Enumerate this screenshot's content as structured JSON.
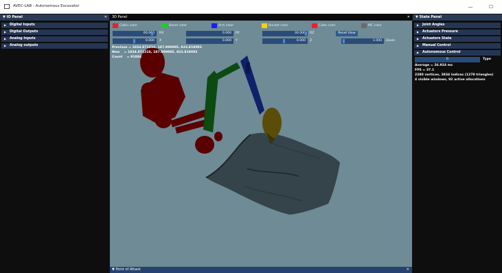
{
  "window": {
    "title": "AVEC-LAB - Autonomous Excavator",
    "minimize": "—",
    "maximize": "☐"
  },
  "io_panel": {
    "title": "IO Panel",
    "close": "✕",
    "items": [
      "Digital Inputs",
      "Digital Outputs",
      "Analog Inputs",
      "Analog outputs"
    ]
  },
  "panel_3d": {
    "title": "3D Panel",
    "close": "✕",
    "colors": [
      {
        "label": "Cabin color",
        "hex": "#e8222b"
      },
      {
        "label": "Boom color",
        "hex": "#18d31c"
      },
      {
        "label": "Arm color",
        "hex": "#1a1ef0"
      },
      {
        "label": "Bucket color",
        "hex": "#f4d20b"
      },
      {
        "label": "Cube color",
        "hex": "#e8222b"
      },
      {
        "label": "MC color",
        "hex": "#6a6a6a"
      }
    ],
    "row1": [
      {
        "value": "60.000",
        "label": "RX"
      },
      {
        "value": "0.000",
        "label": "RY"
      },
      {
        "value": "30.000",
        "label": "RZ"
      }
    ],
    "reset_view": "Reset View",
    "row2": [
      {
        "value": "0.000",
        "label": "X"
      },
      {
        "value": "0.000",
        "label": "Y"
      },
      {
        "value": "0.000",
        "label": "Z"
      },
      {
        "value": "1.000",
        "label": "Zoom"
      }
    ],
    "info_lines": [
      "Previous = 1834.871216, 187.999985, 823.819092",
      "New    = 1834.871216, 187.999985, 823.819092",
      "Count    = 91884"
    ]
  },
  "point_of_attack": {
    "title": "Point of Attack",
    "close": "✕"
  },
  "state_panel": {
    "title": "State Panel",
    "close": "✕",
    "items": [
      "Joint Angles",
      "Actuators Pressure",
      "Actuators State",
      "Manual Control",
      "Autonomous Control"
    ],
    "type_value": "0",
    "type_label": "Type",
    "stats": [
      "Average = 26.924 ms",
      "FPS = 37.1",
      "2280 vertices, 3834 indices (1278 triangles)",
      "4 visible windows, 92 active allocations"
    ]
  }
}
